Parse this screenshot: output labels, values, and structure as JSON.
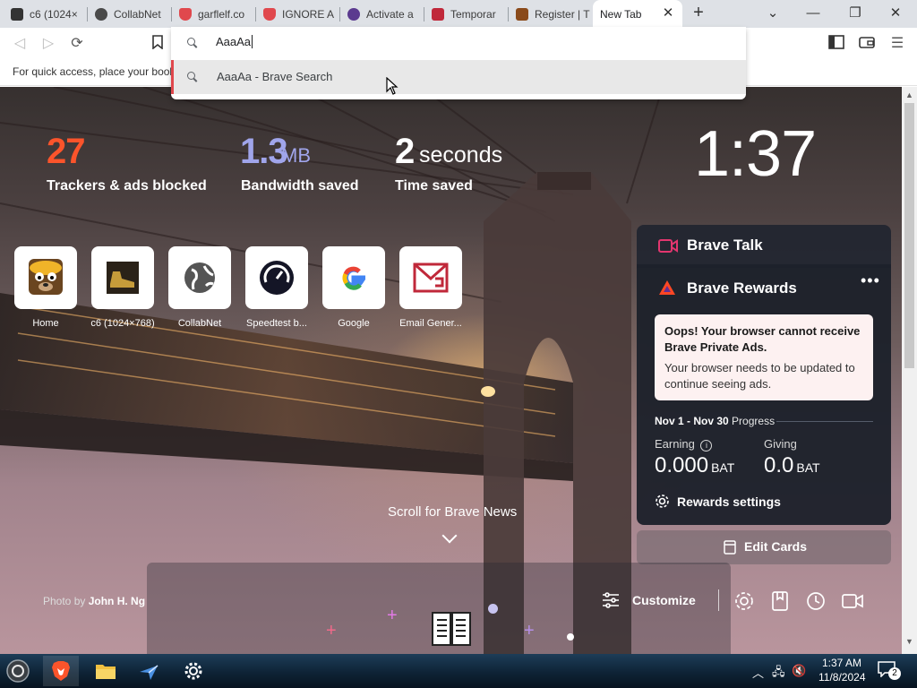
{
  "tabs": [
    {
      "label": "c6 (1024×",
      "favicon_color": "#333333"
    },
    {
      "label": "CollabNet",
      "favicon_color": "#333333"
    },
    {
      "label": "garflelf.co",
      "favicon_color": "#e0484d"
    },
    {
      "label": "IGNORE A",
      "favicon_color": "#e0484d"
    },
    {
      "label": "Activate a",
      "favicon_color": "#5b3a8f"
    },
    {
      "label": "Temporar",
      "favicon_color": "#c0283a"
    },
    {
      "label": "Register | T",
      "favicon_color": "#8a4a1a"
    },
    {
      "label": "New Tab",
      "favicon_color": ""
    }
  ],
  "omnibox": {
    "input_value": "AaaAa",
    "suggestion": "AaaAa - Brave Search"
  },
  "bookmark_bar": {
    "hint": "For quick access, place your book"
  },
  "stats": {
    "trackers_value": "27",
    "trackers_label": "Trackers & ads blocked",
    "bandwidth_value": "1.3",
    "bandwidth_unit": "MB",
    "bandwidth_label": "Bandwidth saved",
    "time_value": "2",
    "time_unit": "seconds",
    "time_label": "Time saved",
    "colors": {
      "trackers": "#fb542b",
      "bandwidth": "#a0a5eb",
      "time": "#ffffff"
    }
  },
  "clock": "1:37",
  "top_sites": [
    {
      "label": "Home",
      "icon": "dog-mascot-icon"
    },
    {
      "label": "c6 (1024×768)",
      "icon": "boot-thumbnail-icon"
    },
    {
      "label": "CollabNet",
      "icon": "globe-icon"
    },
    {
      "label": "Speedtest b...",
      "icon": "speedometer-icon"
    },
    {
      "label": "Google",
      "icon": "google-icon"
    },
    {
      "label": "Email Gener...",
      "icon": "mail-envelope-icon"
    }
  ],
  "brave_talk": {
    "title": "Brave Talk"
  },
  "rewards": {
    "title": "Brave Rewards",
    "menu_glyph": "•••",
    "notice_head": "Oops! Your browser cannot receive Brave Private Ads.",
    "notice_body": "Your browser needs to be updated to continue seeing ads.",
    "progress_period": "Nov 1 - Nov 30",
    "progress_label": "Progress",
    "earning_label": "Earning",
    "earning_value": "0.000",
    "earning_unit": "BAT",
    "giving_label": "Giving",
    "giving_value": "0.0",
    "giving_unit": "BAT",
    "settings_label": "Rewards settings"
  },
  "edit_cards_label": "Edit Cards",
  "news_hint": "Scroll for Brave News",
  "photo_credit": {
    "prefix": "Photo by",
    "author": "John H. Ng"
  },
  "customize_label": "Customize",
  "taskbar": {
    "time": "1:37 AM",
    "date": "11/8/2024",
    "notifications": "2"
  }
}
